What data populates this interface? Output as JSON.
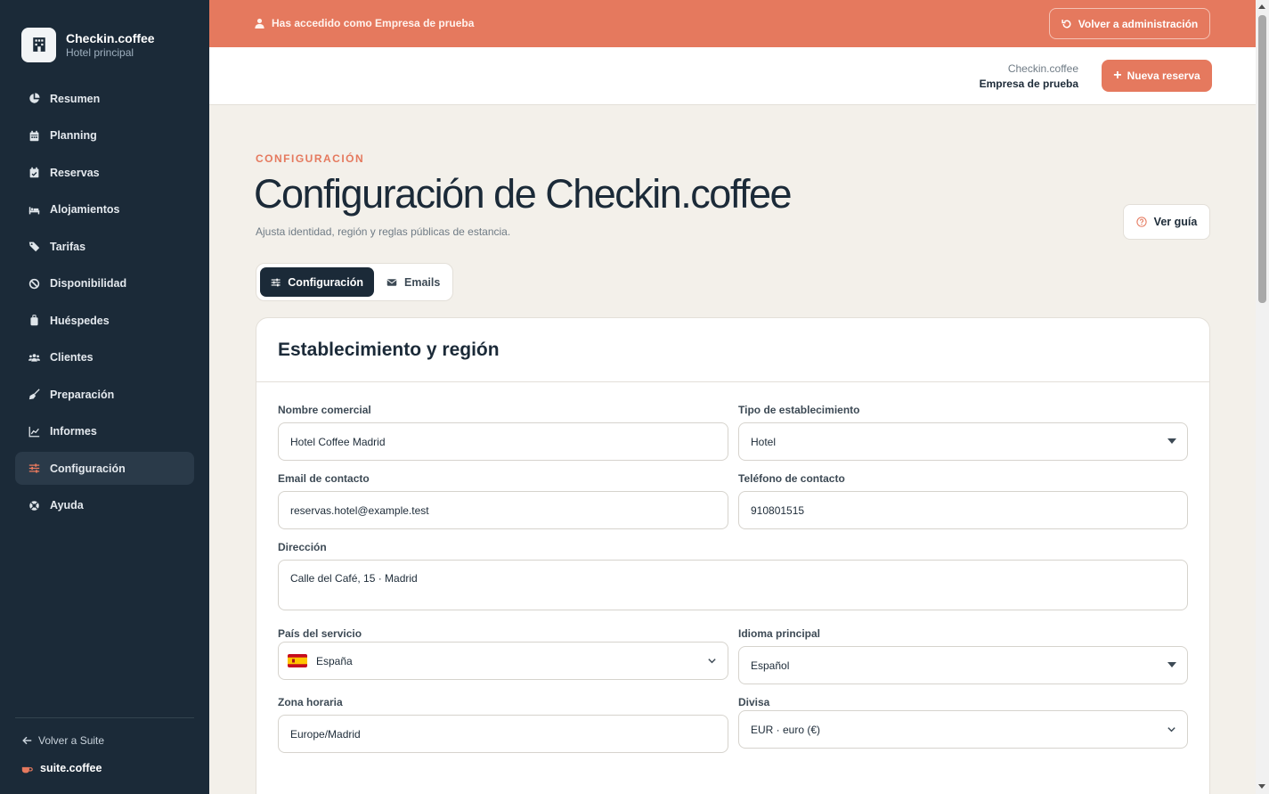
{
  "brand": {
    "name": "Checkin.coffee",
    "subtitle": "Hotel principal",
    "icon": "hotel-icon"
  },
  "sidebar": {
    "items": [
      {
        "label": "Resumen",
        "icon": "pie-chart-icon",
        "active": false
      },
      {
        "label": "Planning",
        "icon": "calendar-icon",
        "active": false
      },
      {
        "label": "Reservas",
        "icon": "calendar-check-icon",
        "active": false
      },
      {
        "label": "Alojamientos",
        "icon": "bed-icon",
        "active": false
      },
      {
        "label": "Tarifas",
        "icon": "tags-icon",
        "active": false
      },
      {
        "label": "Disponibilidad",
        "icon": "ban-icon",
        "active": false
      },
      {
        "label": "Huéspedes",
        "icon": "suitcase-icon",
        "active": false
      },
      {
        "label": "Clientes",
        "icon": "users-icon",
        "active": false
      },
      {
        "label": "Preparación",
        "icon": "broom-icon",
        "active": false
      },
      {
        "label": "Informes",
        "icon": "line-chart-icon",
        "active": false
      },
      {
        "label": "Configuración",
        "icon": "sliders-icon",
        "active": true
      },
      {
        "label": "Ayuda",
        "icon": "lifebuoy-icon",
        "active": false
      }
    ],
    "back_label": "Volver a Suite",
    "suite_label": "suite.coffee"
  },
  "banner": {
    "message": "Has accedido como Empresa de prueba",
    "back_button": "Volver a administración"
  },
  "topbar": {
    "company_line1": "Checkin.coffee",
    "company_line2": "Empresa de prueba",
    "new_button": "Nueva reserva"
  },
  "header": {
    "eyebrow": "CONFIGURACIÓN",
    "title": "Configuración de Checkin.coffee",
    "subtitle": "Ajusta identidad, región y reglas públicas de estancia.",
    "guide_button": "Ver guía"
  },
  "tabs": [
    {
      "label": "Configuración",
      "icon": "sliders-icon",
      "active": true
    },
    {
      "label": "Emails",
      "icon": "envelope-icon",
      "active": false
    }
  ],
  "card": {
    "title": "Establecimiento y región",
    "fields": {
      "nombre_comercial": {
        "label": "Nombre comercial",
        "value": "Hotel Coffee Madrid"
      },
      "tipo_establecimiento": {
        "label": "Tipo de establecimiento",
        "value": "Hotel"
      },
      "email_contacto": {
        "label": "Email de contacto",
        "value": "reservas.hotel@example.test"
      },
      "telefono_contacto": {
        "label": "Teléfono de contacto",
        "value": "910801515"
      },
      "direccion": {
        "label": "Dirección",
        "value": "Calle del Café, 15 · Madrid"
      },
      "pais": {
        "label": "País del servicio",
        "value": "España"
      },
      "idioma": {
        "label": "Idioma principal",
        "value": "Español"
      },
      "zona_horaria": {
        "label": "Zona horaria",
        "value": "Europe/Madrid"
      },
      "divisa": {
        "label": "Divisa",
        "value": "EUR · euro (€)"
      }
    }
  },
  "colors": {
    "accent": "#e5795e",
    "sidebar_bg": "#1b2a38",
    "page_bg": "#f3f0ea"
  }
}
